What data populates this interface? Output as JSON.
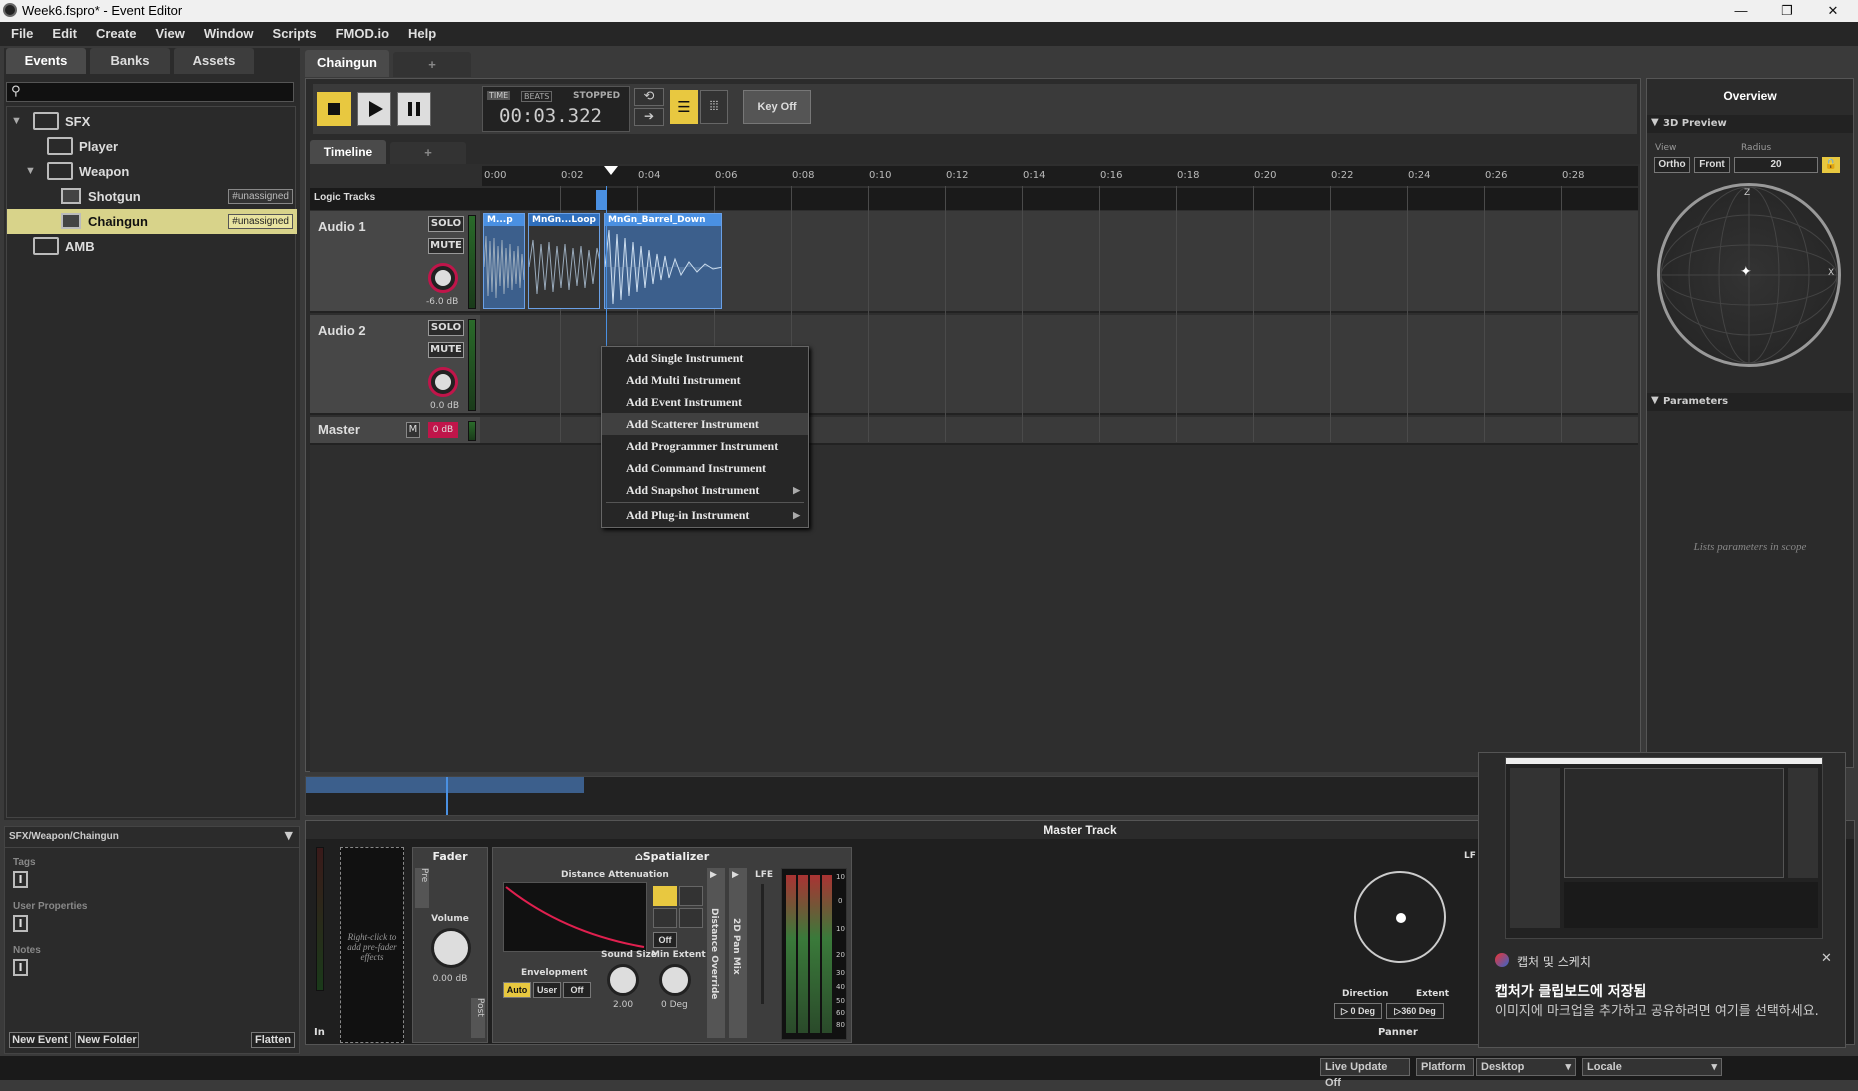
{
  "window": {
    "title": "Week6.fspro* - Event Editor",
    "min": "—",
    "restore": "❐",
    "close": "✕"
  },
  "menu": [
    "File",
    "Edit",
    "Create",
    "View",
    "Window",
    "Scripts",
    "FMOD.io",
    "Help"
  ],
  "browser": {
    "tabs": [
      "Events",
      "Banks",
      "Assets"
    ],
    "tree": [
      {
        "label": "SFX"
      },
      {
        "label": "Player"
      },
      {
        "label": "Weapon"
      },
      {
        "label": "Shotgun",
        "badge": "#unassigned"
      },
      {
        "label": "Chaingun",
        "badge": "#unassigned"
      },
      {
        "label": "AMB"
      }
    ],
    "path": "SFX/Weapon/Chaingun",
    "tags_label": "Tags",
    "user_props_label": "User Properties",
    "notes_label": "Notes",
    "new_event": "New Event",
    "new_folder": "New Folder",
    "flatten": "Flatten"
  },
  "editor": {
    "event_tab": "Chaingun",
    "add_tab": "+",
    "time_label": "TIME",
    "beats_label": "BEATS",
    "state": "STOPPED",
    "timecode": "00:03.322",
    "key_off": "Key Off",
    "timeline_tab": "Timeline",
    "timeline_add": "+",
    "ruler": [
      "0:00",
      "0:02",
      "0:04",
      "0:06",
      "0:08",
      "0:10",
      "0:12",
      "0:14",
      "0:16",
      "0:18",
      "0:20",
      "0:22",
      "0:24",
      "0:26",
      "0:28"
    ],
    "logic_tracks": "Logic Tracks",
    "tracks": [
      {
        "name": "Audio 1",
        "solo": "SOLO",
        "mute": "MUTE",
        "vol": "-6.0 dB"
      },
      {
        "name": "Audio 2",
        "solo": "SOLO",
        "mute": "MUTE",
        "vol": "0.0 dB"
      }
    ],
    "master": {
      "name": "Master",
      "m": "M",
      "vol": "0 dB"
    },
    "clips": [
      "M...p",
      "MnGn...Loop",
      "MnGn_Barrel_Down"
    ]
  },
  "context_menu": [
    "Add Single Instrument",
    "Add Multi Instrument",
    "Add Event Instrument",
    "Add Scatterer Instrument",
    "Add Programmer Instrument",
    "Add Command Instrument",
    "Add Snapshot Instrument",
    "Add Plug-in Instrument"
  ],
  "overview": {
    "title": "Overview",
    "preview": "3D Preview",
    "view_label": "View",
    "radius_label": "Radius",
    "ortho": "Ortho",
    "front": "Front",
    "radius": "20",
    "z": "Z",
    "x": "X",
    "parameters": "Parameters",
    "params_hint": "Lists parameters in scope"
  },
  "master_track": {
    "title": "Master Track",
    "in": "In",
    "prefader_hint": "Right-click to add pre-fader effects",
    "fader": "Fader",
    "pre": "Pre",
    "post": "Post",
    "volume": "Volume",
    "volume_val": "0.00 dB",
    "spatializer": "Spatializer",
    "distance_att": "Distance Attenuation",
    "off": "Off",
    "envelopment": "Envelopment",
    "auto": "Auto",
    "user": "User",
    "off2": "Off",
    "sound_size": "Sound Size",
    "sound_size_val": "2.00",
    "min_extent": "Min Extent",
    "min_extent_val": "0 Deg",
    "distance_override": "Distance Override",
    "pan_mix": "2D Pan Mix",
    "lfe": "LFE",
    "meter_scale": [
      "10",
      "0",
      "10",
      "20",
      "30",
      "40",
      "50",
      "60",
      "80"
    ],
    "direction": "Direction",
    "direction_val": "0 Deg",
    "extent": "Extent",
    "extent_val": "360 Deg",
    "panner": "Panner",
    "lfe2": "LF"
  },
  "status": {
    "live_update": "Live Update Off",
    "platform": "Platform",
    "platform_val": "Desktop",
    "locale": "Locale"
  },
  "toast": {
    "app": "캡처 및 스케치",
    "title": "캡처가 클립보드에 저장됨",
    "body": "이미지에 마크업을 추가하고 공유하려면 여기를 선택하세요.",
    "close": "✕"
  },
  "colors": {
    "accent": "#e8c840",
    "selected_row": "#d8d38a",
    "clip": "#4a90e2",
    "knob": "#c0154a"
  }
}
